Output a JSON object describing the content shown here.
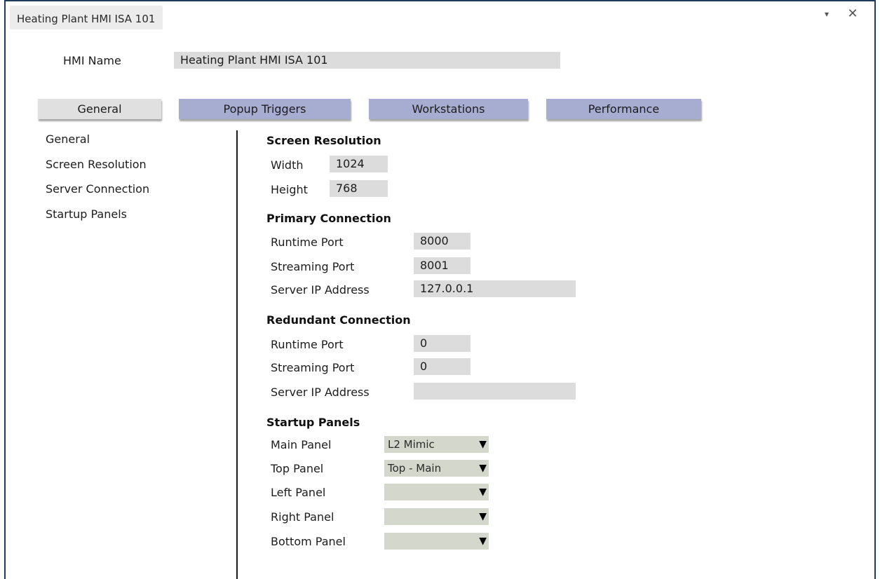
{
  "window": {
    "tab_title": "Heating Plant HMI ISA 101",
    "dropdown_glyph": "▾",
    "close_glyph": "✕"
  },
  "hmi_name": {
    "label": "HMI Name",
    "value": "Heating Plant HMI ISA 101"
  },
  "tabs": [
    {
      "label": "General",
      "active": true
    },
    {
      "label": "Popup Triggers",
      "active": false
    },
    {
      "label": "Workstations",
      "active": false
    },
    {
      "label": "Performance",
      "active": false
    }
  ],
  "sidebar": {
    "items": [
      {
        "label": "General"
      },
      {
        "label": "Screen Resolution"
      },
      {
        "label": "Server Connection"
      },
      {
        "label": "Startup Panels"
      }
    ]
  },
  "screen_resolution": {
    "heading": "Screen Resolution",
    "width_label": "Width",
    "width_value": "1024",
    "height_label": "Height",
    "height_value": "768"
  },
  "primary_connection": {
    "heading": "Primary Connection",
    "runtime_port_label": "Runtime Port",
    "runtime_port_value": "8000",
    "streaming_port_label": "Streaming Port",
    "streaming_port_value": "8001",
    "server_ip_label": "Server IP Address",
    "server_ip_value": "127.0.0.1"
  },
  "redundant_connection": {
    "heading": "Redundant Connection",
    "runtime_port_label": "Runtime Port",
    "runtime_port_value": "0",
    "streaming_port_label": "Streaming Port",
    "streaming_port_value": "0",
    "server_ip_label": "Server IP Address",
    "server_ip_value": ""
  },
  "startup_panels": {
    "heading": "Startup Panels",
    "main_label": "Main Panel",
    "main_value": "L2 Mimic",
    "top_label": "Top Panel",
    "top_value": "Top - Main",
    "left_label": "Left Panel",
    "left_value": "",
    "right_label": "Right Panel",
    "right_value": "",
    "bottom_label": "Bottom Panel",
    "bottom_value": "",
    "arrow_glyph": "▼"
  },
  "colors": {
    "active_tab": "#e0e0e0",
    "inactive_tab": "#a6add0",
    "field_bg": "#dcdcdc",
    "select_bg": "#d3d7cc",
    "window_border": "#1e3a5c"
  }
}
